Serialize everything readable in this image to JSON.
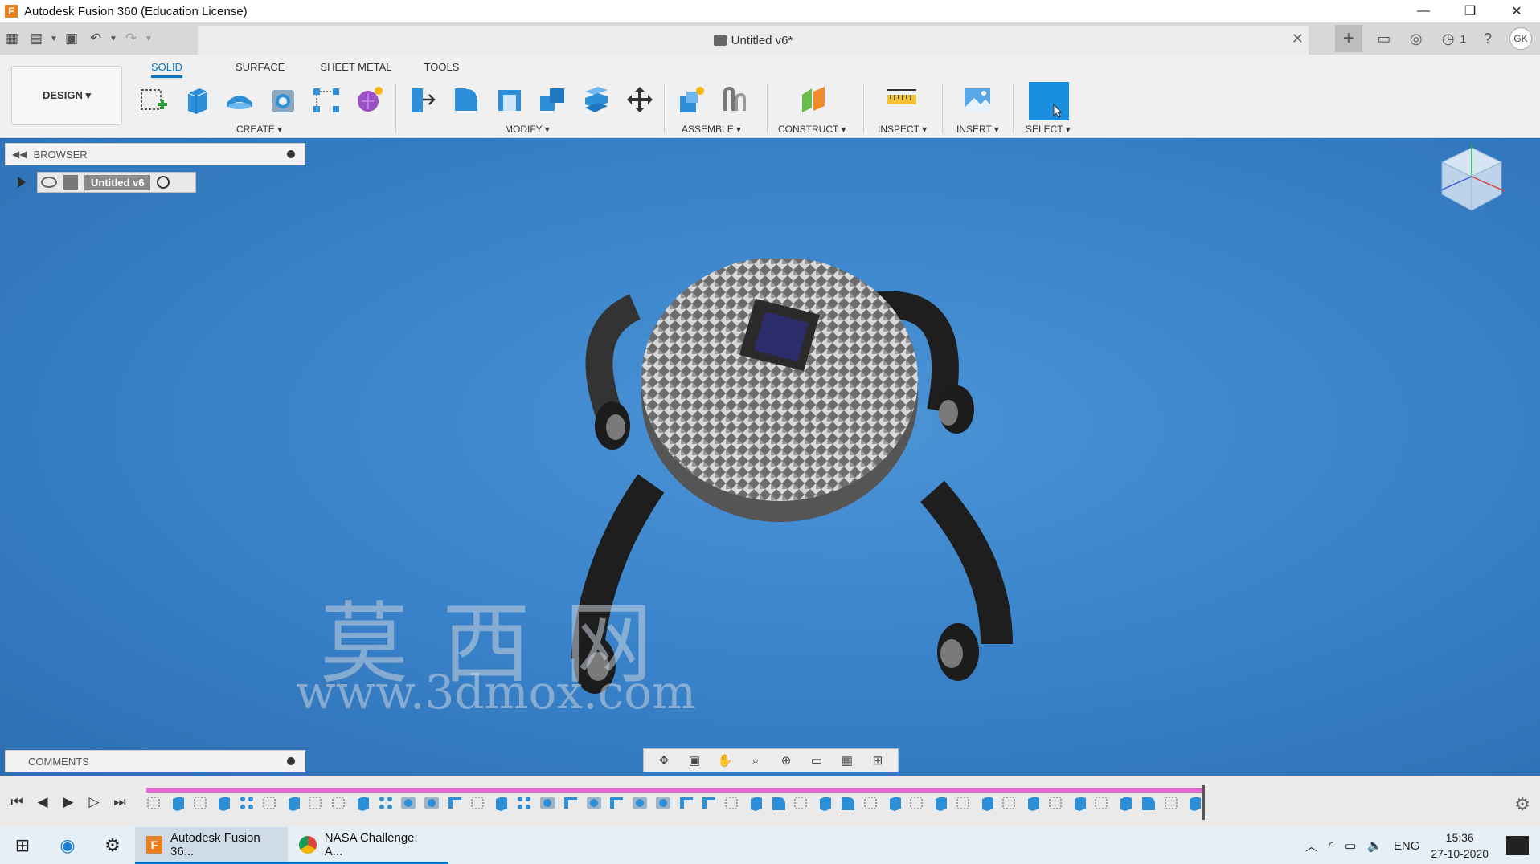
{
  "window": {
    "title": "Autodesk Fusion 360 (Education License)",
    "minimize": "—",
    "restore": "❐",
    "close": "✕"
  },
  "document": {
    "title": "Untitled v6*",
    "close": "✕"
  },
  "quick_access": {
    "job_count": "1",
    "user_initials": "GK"
  },
  "ribbon": {
    "workspace": "DESIGN ▾",
    "tabs": [
      "SOLID",
      "SURFACE",
      "SHEET METAL",
      "TOOLS"
    ],
    "groups": {
      "create": "CREATE ▾",
      "modify": "MODIFY ▾",
      "assemble": "ASSEMBLE ▾",
      "construct": "CONSTRUCT ▾",
      "inspect": "INSPECT ▾",
      "insert": "INSERT ▾",
      "select": "SELECT ▾"
    }
  },
  "browser": {
    "label": "BROWSER",
    "root_node": "Untitled v6"
  },
  "comments": {
    "label": "COMMENTS"
  },
  "watermark": {
    "chinese": "莫西网",
    "url": "www.3dmox.com"
  },
  "taskbar": {
    "apps": [
      {
        "label": "Autodesk Fusion 36..."
      },
      {
        "label": "NASA Challenge: A..."
      }
    ],
    "language": "ENG",
    "time": "15:36",
    "date": "27-10-2020"
  },
  "colors": {
    "accent": "#0a74c4",
    "viewport": "#3a84cc",
    "timeline_track": "#e46ad0",
    "select_tool": "#1a8fe0"
  }
}
